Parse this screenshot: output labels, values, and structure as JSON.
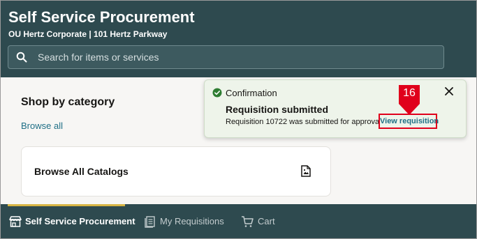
{
  "header": {
    "title": "Self Service Procurement",
    "subtitle": "OU Hertz Corporate | 101 Hertz Parkway",
    "search_placeholder": "Search for items or services"
  },
  "main": {
    "section_title": "Shop by category",
    "browse_all": "Browse all",
    "card_title": "Browse All Catalogs"
  },
  "toast": {
    "label": "Confirmation",
    "title": "Requisition submitted",
    "message": "Requisition 10722 was submitted for approval",
    "link": "View requisition"
  },
  "step_marker": "16",
  "bottom_nav": {
    "tabs": [
      {
        "label": "Self Service Procurement",
        "icon": "store-icon",
        "active": true
      },
      {
        "label": "My Requisitions",
        "icon": "requisitions-icon",
        "active": false
      },
      {
        "label": "Cart",
        "icon": "cart-icon",
        "active": false
      }
    ]
  },
  "colors": {
    "header_bg": "#2e4a4f",
    "link": "#1f6f86",
    "success": "#2e7d32",
    "highlight": "#e0001b",
    "active_tab": "#d7b544"
  }
}
